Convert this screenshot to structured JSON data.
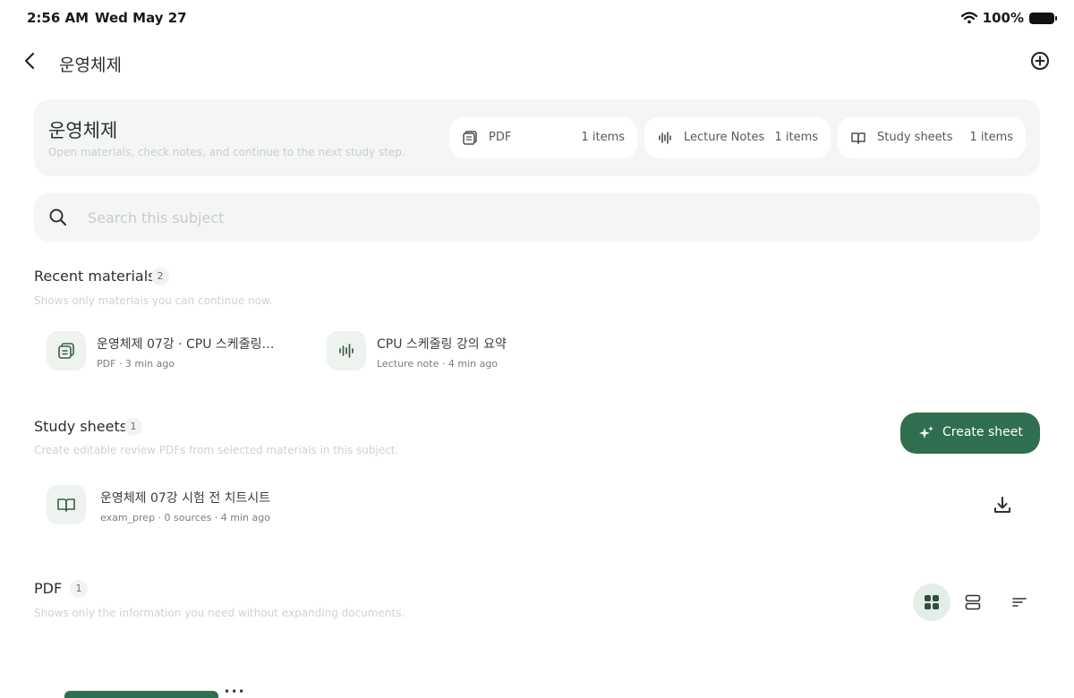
{
  "status": {
    "time": "2:56 AM",
    "date": "Wed May 27",
    "battery": "100%"
  },
  "nav": {
    "title": "운영체제"
  },
  "header": {
    "title": "운영체제",
    "subtitle": "Open materials, check notes, and continue to the next study step.",
    "stats": [
      {
        "label": "PDF",
        "count": "1 items",
        "icon": "pdf-icon"
      },
      {
        "label": "Lecture Notes",
        "count": "1 items",
        "icon": "waveform-icon"
      },
      {
        "label": "Study sheets",
        "count": "1 items",
        "icon": "book-icon"
      }
    ]
  },
  "search": {
    "placeholder": "Search this subject"
  },
  "recent": {
    "title": "Recent materials",
    "count": "2",
    "subtitle": "Shows only materials you can continue now.",
    "items": [
      {
        "title": "운영체제 07강 · CPU 스케줄링…",
        "meta": "PDF · 3 min ago",
        "icon": "pdf-icon"
      },
      {
        "title": "CPU 스케줄링 강의 요약",
        "meta": "Lecture note · 4 min ago",
        "icon": "waveform-icon"
      }
    ]
  },
  "sheets": {
    "title": "Study sheets",
    "count": "1",
    "subtitle": "Create editable review PDFs from selected materials in this subject.",
    "create_label": "Create sheet",
    "items": [
      {
        "title": "운영체제 07강 시험 전 치트시트",
        "meta": "exam_prep · 0 sources · 4 min ago",
        "icon": "book-icon"
      }
    ]
  },
  "pdf": {
    "title": "PDF",
    "count": "1",
    "subtitle": "Shows only the information you need without expanding documents.",
    "view_modes": [
      "grid-icon",
      "list-icon",
      "sort-icon"
    ],
    "more_label": "•••"
  },
  "colors": {
    "accent": "#2f6f4f",
    "surface": "#f4f6f5",
    "icon_bg": "#eef3ef"
  }
}
